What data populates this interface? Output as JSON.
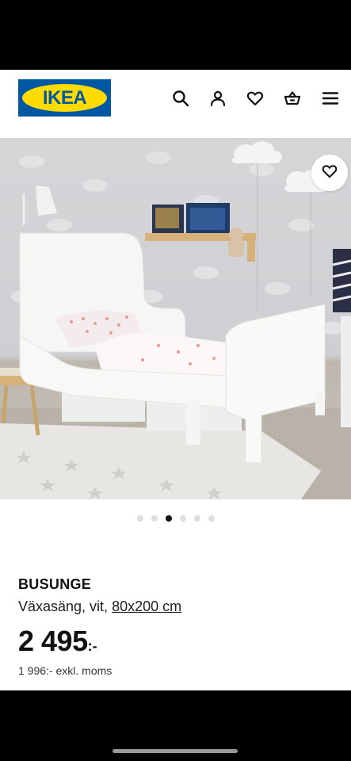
{
  "header": {
    "logo_text": "IKEA",
    "icons": [
      "search-icon",
      "user-icon",
      "heart-icon",
      "cart-icon",
      "menu-icon"
    ]
  },
  "gallery": {
    "image_count": 6,
    "active_index": 2
  },
  "product": {
    "name": "BUSUNGE",
    "description": "Växasäng, vit, ",
    "size_link": "80x200 cm",
    "price_amount": "2 495",
    "price_suffix": ":-",
    "price_excl_vat": "1 996:- exkl. moms"
  },
  "colors": {
    "brand_blue": "#0058a3",
    "brand_yellow": "#ffdb00"
  }
}
